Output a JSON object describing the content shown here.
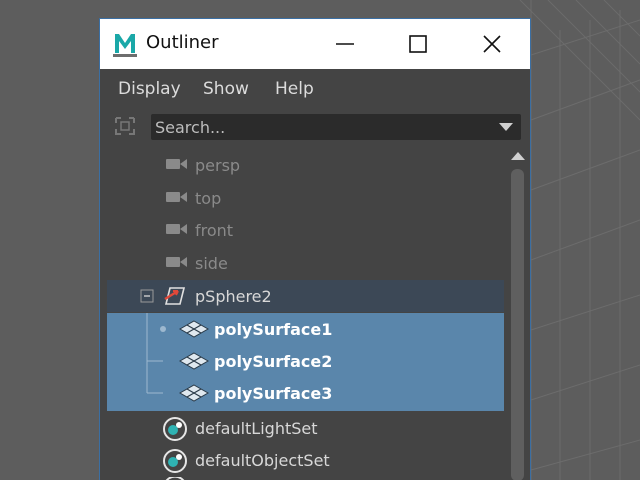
{
  "window": {
    "title": "Outliner",
    "logo_letter": "M",
    "accent": "#3b6fa3"
  },
  "menu": [
    {
      "label": "Display"
    },
    {
      "label": "Show"
    },
    {
      "label": "Help"
    }
  ],
  "search": {
    "placeholder": "Search..."
  },
  "outliner": {
    "items": [
      {
        "label": "persp",
        "icon": "camera-icon",
        "state": "dimmed"
      },
      {
        "label": "top",
        "icon": "camera-icon",
        "state": "dimmed"
      },
      {
        "label": "front",
        "icon": "camera-icon",
        "state": "dimmed"
      },
      {
        "label": "side",
        "icon": "camera-icon",
        "state": "dimmed"
      },
      {
        "label": "pSphere2",
        "icon": "transform-icon",
        "state": "expanded-parent"
      },
      {
        "label": "polySurface1",
        "icon": "mesh-icon",
        "state": "selected"
      },
      {
        "label": "polySurface2",
        "icon": "mesh-icon",
        "state": "selected"
      },
      {
        "label": "polySurface3",
        "icon": "mesh-icon",
        "state": "selected"
      },
      {
        "label": "defaultLightSet",
        "icon": "set-icon",
        "state": "normal"
      },
      {
        "label": "defaultObjectSet",
        "icon": "set-icon",
        "state": "normal"
      }
    ]
  },
  "colors": {
    "selection": "#5a86ab",
    "parent_row": "#3c4856",
    "panel": "#444444"
  }
}
